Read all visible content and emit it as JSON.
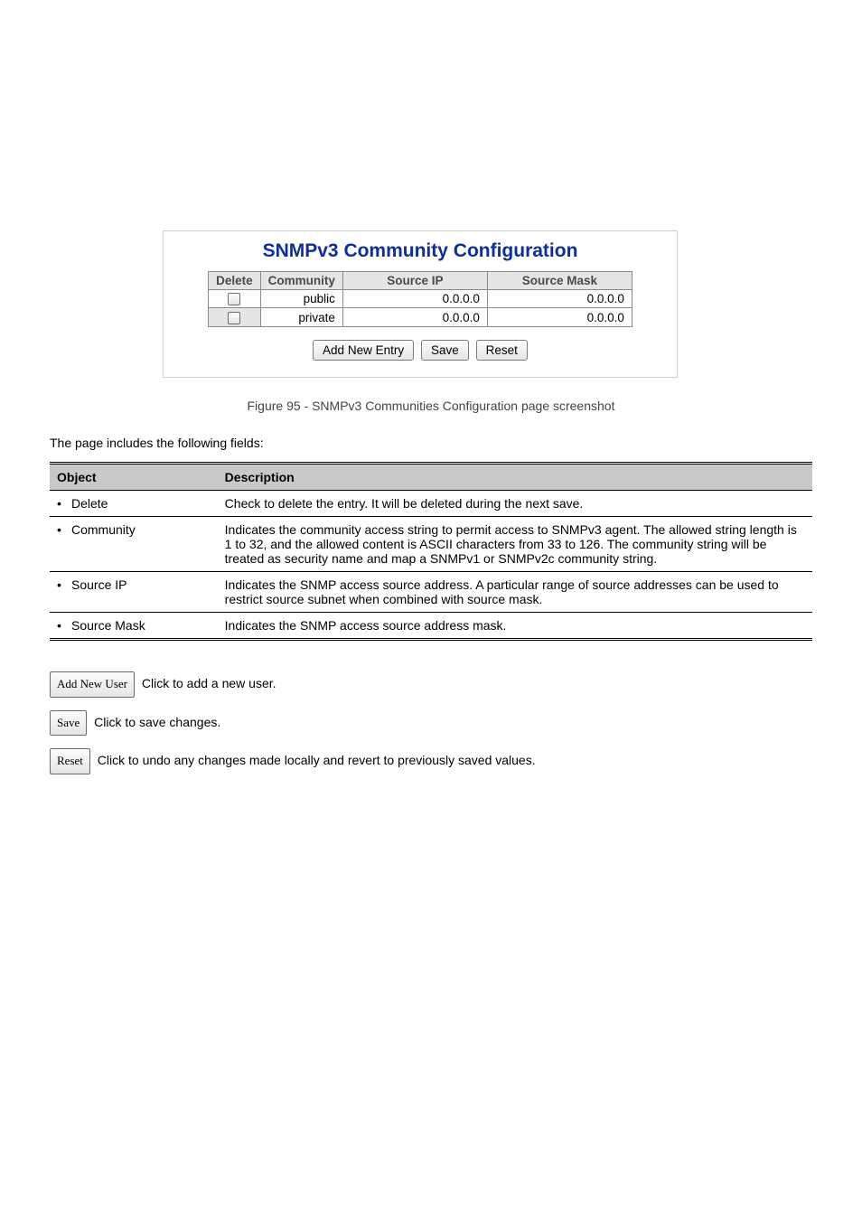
{
  "panel": {
    "title": "SNMPv3 Community Configuration",
    "headers": [
      "Delete",
      "Community",
      "Source IP",
      "Source Mask"
    ],
    "rows": [
      {
        "community": "public",
        "sourceIp": "0.0.0.0",
        "sourceMask": "0.0.0.0",
        "greyed": false
      },
      {
        "community": "private",
        "sourceIp": "0.0.0.0",
        "sourceMask": "0.0.0.0",
        "greyed": true
      }
    ],
    "buttons": {
      "addNewEntry": "Add New Entry",
      "save": "Save",
      "reset": "Reset"
    }
  },
  "figureCaption": "Figure 95 - SNMPv3 Communities Configuration page screenshot",
  "descIntro": "The page includes the following fields:",
  "descTable": {
    "head": [
      "Object",
      "Description"
    ],
    "rows": [
      {
        "obj": "Delete",
        "desc": "Check to delete the entry. It will be deleted during the next save."
      },
      {
        "obj": "Community",
        "desc": "Indicates the community access string to permit access to SNMPv3 agent. The allowed string length is 1 to 32, and the allowed content is ASCII characters from 33 to 126. The community string will be treated as security name and map a SNMPv1 or SNMPv2c community string."
      },
      {
        "obj": "Source IP",
        "desc": "Indicates the SNMP access source address. A particular range of source addresses can be used to restrict source subnet when combined with source mask."
      },
      {
        "obj": "Source Mask",
        "desc": "Indicates the SNMP access source address mask."
      }
    ]
  },
  "notes": {
    "addNewUser": {
      "btn": "Add New User",
      "text": "Click to add a new user."
    },
    "save": {
      "btn": "Save",
      "text": "Click to save changes."
    },
    "reset": {
      "btn": "Reset",
      "text": "Click to undo any changes made locally and revert to previously saved values."
    }
  }
}
